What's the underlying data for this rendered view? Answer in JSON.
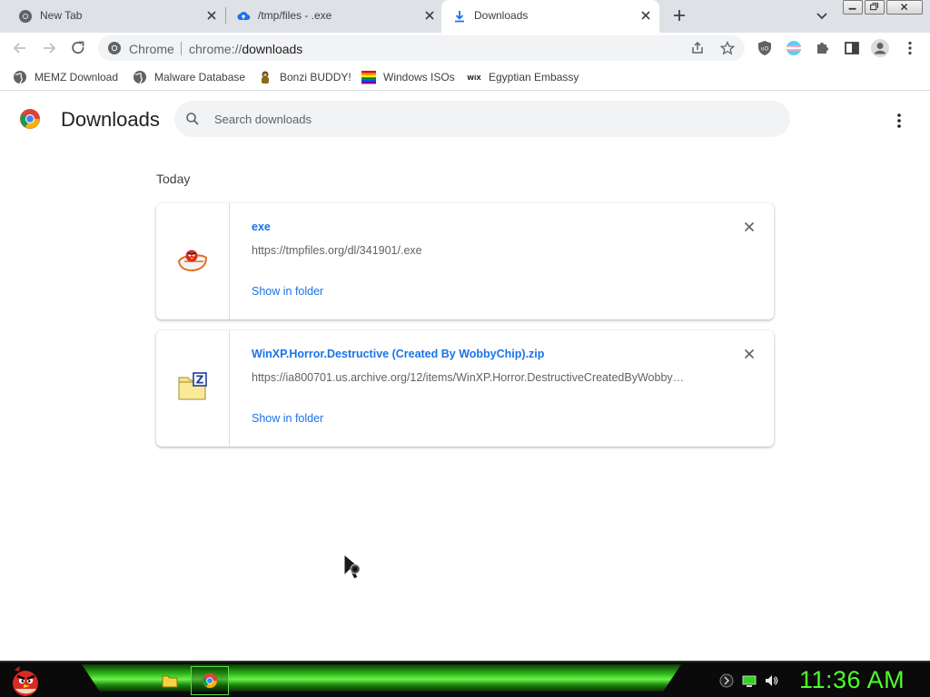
{
  "tabs": [
    {
      "title": "New Tab",
      "active": false,
      "icon": "chrome-icon"
    },
    {
      "title": "/tmp/files - .exe",
      "active": false,
      "icon": "cloud-upload-icon"
    },
    {
      "title": "Downloads",
      "active": true,
      "icon": "download-icon"
    }
  ],
  "omnibox": {
    "site_label": "Chrome",
    "url_prefix": "chrome://",
    "url_host": "downloads"
  },
  "bookmarks": [
    {
      "label": "MEMZ Download",
      "icon": "globe-icon"
    },
    {
      "label": "Malware Database",
      "icon": "globe-icon"
    },
    {
      "label": "Bonzi BUDDY!",
      "icon": "bonzi-icon"
    },
    {
      "label": "Windows ISOs",
      "icon": "rainbow-flag-icon"
    },
    {
      "label": "Egyptian Embassy",
      "icon": "wix-icon"
    }
  ],
  "downloads_page": {
    "title": "Downloads",
    "search_placeholder": "Search downloads",
    "section_label": "Today",
    "items": [
      {
        "file_name": "exe",
        "url": "https://tmpfiles.org/dl/341901/.exe",
        "action": "Show in folder",
        "icon": "angry-bird-icon"
      },
      {
        "file_name": "WinXP.Horror.Destructive (Created By WobbyChip).zip",
        "url": "https://ia800701.us.archive.org/12/items/WinXP.Horror.DestructiveCreatedByWobby…",
        "action": "Show in folder",
        "icon": "zip-folder-icon"
      }
    ]
  },
  "taskbar": {
    "clock": "11:36 AM",
    "clock_color": "#4cff2a"
  },
  "colors": {
    "link": "#1a73e8",
    "tabstrip": "#dee1e6",
    "omnibox": "#f1f3f4"
  }
}
